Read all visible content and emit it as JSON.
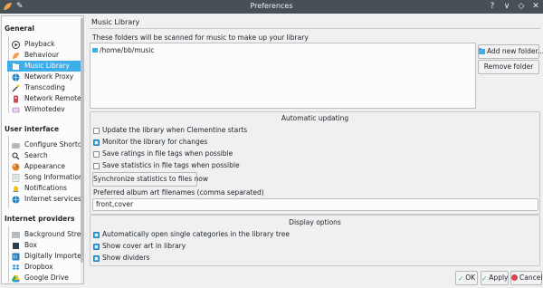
{
  "window": {
    "title": "Preferences",
    "buttons": [
      "?",
      "∨",
      "◇",
      "✕"
    ]
  },
  "sidebar": {
    "sections": [
      {
        "heading": "General",
        "items": [
          {
            "label": "Playback",
            "icon": "play-icon",
            "color": "#31363b"
          },
          {
            "label": "Behaviour",
            "icon": "clementine-icon",
            "color": "#f0a050"
          },
          {
            "label": "Music Library",
            "icon": "library-icon",
            "color": "#3daee9",
            "selected": true
          },
          {
            "label": "Network Proxy",
            "icon": "globe-icon",
            "color": "#2980b9"
          },
          {
            "label": "Transcoding",
            "icon": "wand-icon",
            "color": "#232629"
          },
          {
            "label": "Network Remote",
            "icon": "remote-icon",
            "color": "#da4453"
          },
          {
            "label": "Wiimotedev",
            "icon": "wiimote-icon",
            "color": "#9b59b6"
          }
        ]
      },
      {
        "heading": "User interface",
        "items": [
          {
            "label": "Configure Shortc...",
            "icon": "keyboard-icon",
            "color": "#7f8c8d"
          },
          {
            "label": "Search",
            "icon": "search-icon",
            "color": "#232629"
          },
          {
            "label": "Appearance",
            "icon": "palette-icon",
            "color": "#e67e22"
          },
          {
            "label": "Song Information",
            "icon": "info-icon",
            "color": "#95a5a6"
          },
          {
            "label": "Notifications",
            "icon": "bell-icon",
            "color": "#f1c40f"
          },
          {
            "label": "Internet services",
            "icon": "globe-icon",
            "color": "#2980b9"
          }
        ]
      },
      {
        "heading": "Internet providers",
        "items": [
          {
            "label": "Background Stre...",
            "icon": "stream-icon",
            "color": "#7f8c8d"
          },
          {
            "label": "Box",
            "icon": "box-icon",
            "color": "#2c3e50"
          },
          {
            "label": "Digitally Imported",
            "icon": "di-icon",
            "color": "#2980b9"
          },
          {
            "label": "Dropbox",
            "icon": "dropbox-icon",
            "color": "#3498db"
          },
          {
            "label": "Google Drive",
            "icon": "drive-icon",
            "color": "#27ae60"
          }
        ]
      }
    ]
  },
  "main": {
    "title": "Music Library",
    "description": "These folders will be scanned for music to make up your library",
    "folders": [
      "/home/bb/music"
    ],
    "add_folder_label": "Add new folder...",
    "remove_folder_label": "Remove folder",
    "auto_update": {
      "title": "Automatic updating",
      "options": [
        {
          "label": "Update the library when Clementine starts",
          "checked": false
        },
        {
          "label": "Monitor the library for changes",
          "checked": true
        },
        {
          "label": "Save ratings in file tags when possible",
          "checked": false
        },
        {
          "label": "Save statistics in file tags when possible",
          "checked": false
        }
      ],
      "sync_button_label": "Synchronize statistics to files now",
      "art_filenames_label": "Preferred album art filenames (comma separated)",
      "art_filenames_value": "front,cover"
    },
    "display": {
      "title": "Display options",
      "options": [
        {
          "label": "Automatically open single categories in the library tree",
          "checked": true
        },
        {
          "label": "Show cover art in library",
          "checked": true
        },
        {
          "label": "Show dividers",
          "checked": true
        }
      ]
    }
  },
  "footer": {
    "ok_label": "OK",
    "apply_label": "Apply",
    "cancel_label": "Cancel"
  }
}
